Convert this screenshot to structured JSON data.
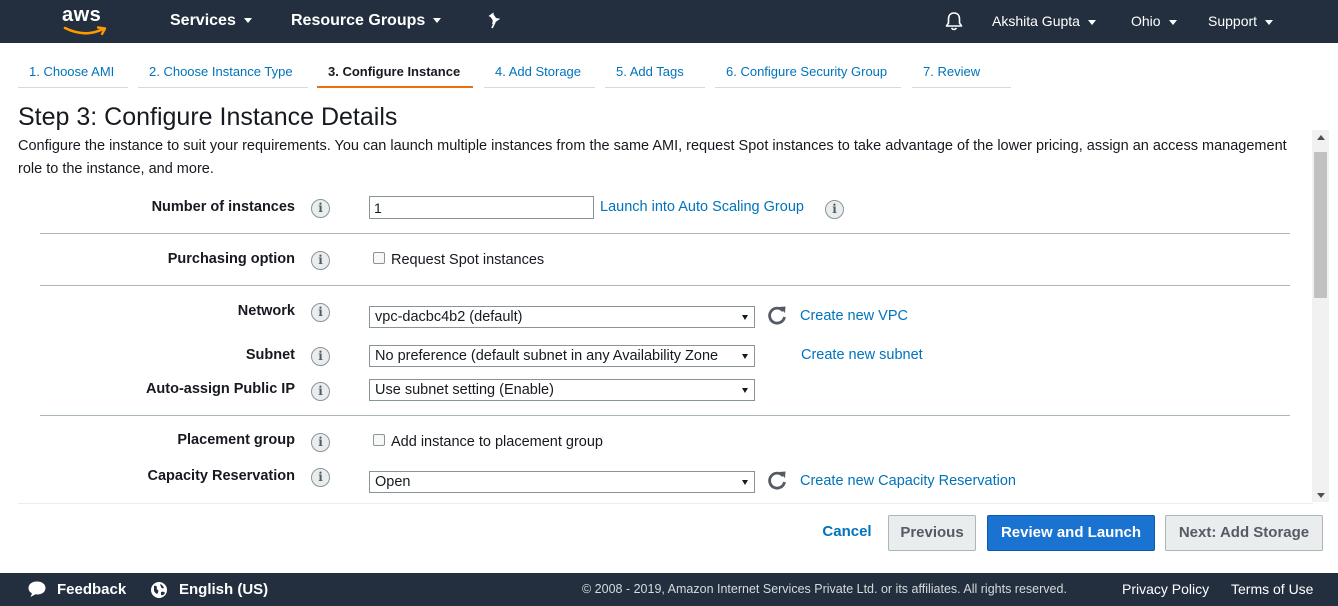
{
  "topnav": {
    "logo": "aws",
    "services": "Services",
    "resource_groups": "Resource Groups",
    "pin_icon": "pin-icon",
    "bell_icon": "bell-icon",
    "user": "Akshita Gupta",
    "region": "Ohio",
    "support": "Support"
  },
  "tabs": [
    {
      "label": "1. Choose AMI"
    },
    {
      "label": "2. Choose Instance Type"
    },
    {
      "label": "3. Configure Instance",
      "active": true
    },
    {
      "label": "4. Add Storage"
    },
    {
      "label": "5. Add Tags"
    },
    {
      "label": "6. Configure Security Group"
    },
    {
      "label": "7. Review"
    }
  ],
  "page": {
    "title": "Step 3: Configure Instance Details",
    "description": "Configure the instance to suit your requirements. You can launch multiple instances from the same AMI, request Spot instances to take advantage of the lower pricing, assign an access management role to the instance, and more."
  },
  "form": {
    "number_of_instances": {
      "label": "Number of instances",
      "value": "1",
      "link": "Launch into Auto Scaling Group"
    },
    "purchasing_option": {
      "label": "Purchasing option",
      "checkbox_label": "Request Spot instances",
      "checked": false
    },
    "network": {
      "label": "Network",
      "value": "vpc-dacbc4b2 (default)",
      "link": "Create new VPC"
    },
    "subnet": {
      "label": "Subnet",
      "value": "No preference (default subnet in any Availability Zone",
      "link": "Create new subnet"
    },
    "auto_assign_ip": {
      "label": "Auto-assign Public IP",
      "value": "Use subnet setting (Enable)"
    },
    "placement_group": {
      "label": "Placement group",
      "checkbox_label": "Add instance to placement group",
      "checked": false
    },
    "capacity_reservation": {
      "label": "Capacity Reservation",
      "value": "Open",
      "link": "Create new Capacity Reservation"
    }
  },
  "buttons": {
    "cancel": "Cancel",
    "previous": "Previous",
    "review_launch": "Review and Launch",
    "next": "Next: Add Storage"
  },
  "footer": {
    "feedback": "Feedback",
    "language": "English (US)",
    "copyright": "© 2008 - 2019, Amazon Internet Services Private Ltd. or its affiliates. All rights reserved.",
    "privacy": "Privacy Policy",
    "terms": "Terms of Use"
  },
  "colors": {
    "nav_bg": "#232f3e",
    "link": "#0073bb",
    "active_tab_underline": "#ec7211",
    "primary_button": "#1a73d0"
  }
}
